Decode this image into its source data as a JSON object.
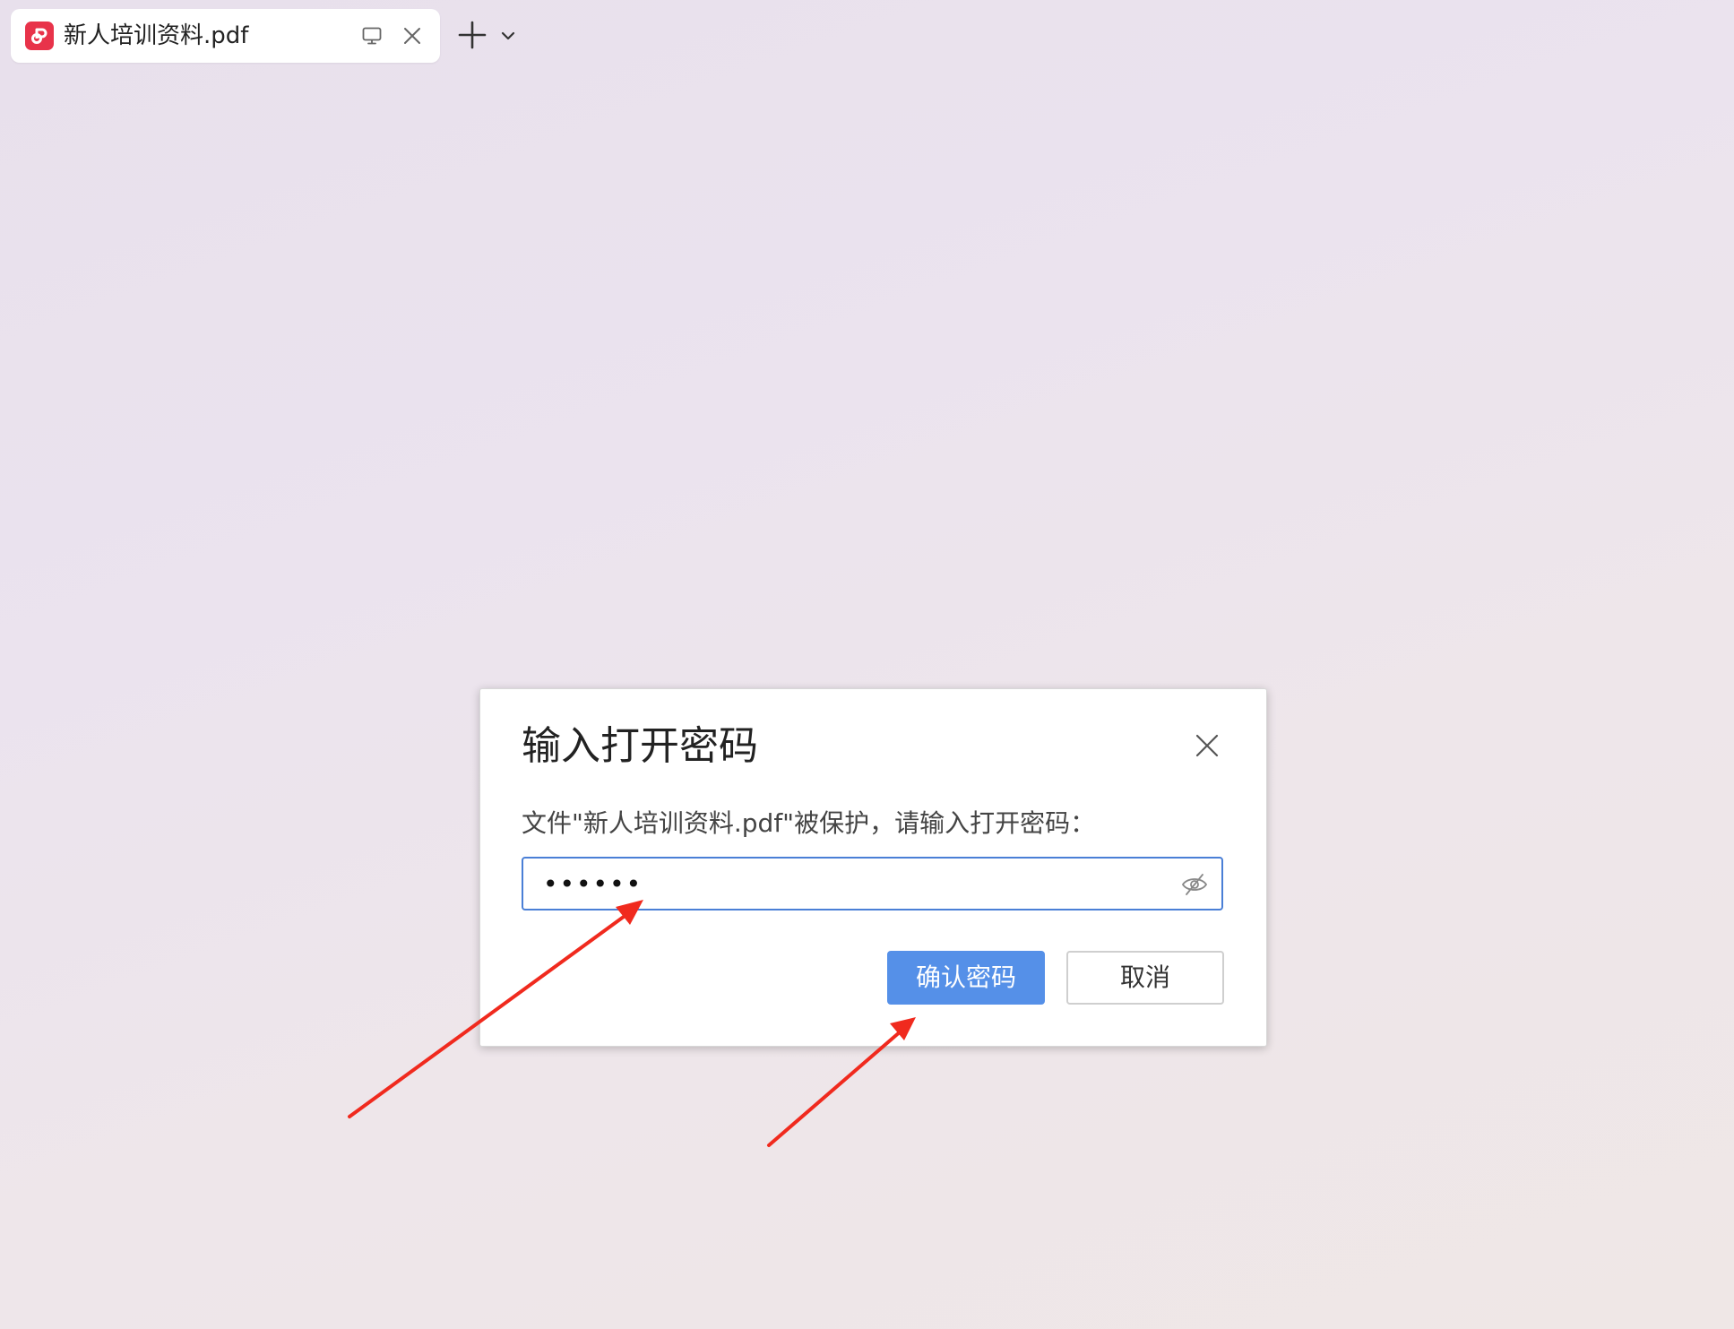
{
  "tab": {
    "title": "新人培训资料.pdf",
    "icon": "pdf-app-icon",
    "accent": "#e8334a"
  },
  "dialog": {
    "title": "输入打开密码",
    "message": "文件\"新人培训资料.pdf\"被保护，请输入打开密码：",
    "password_value": "••••••",
    "confirm_label": "确认密码",
    "cancel_label": "取消",
    "confirm_color": "#5590e8",
    "annotation_color": "#f02a1e"
  }
}
